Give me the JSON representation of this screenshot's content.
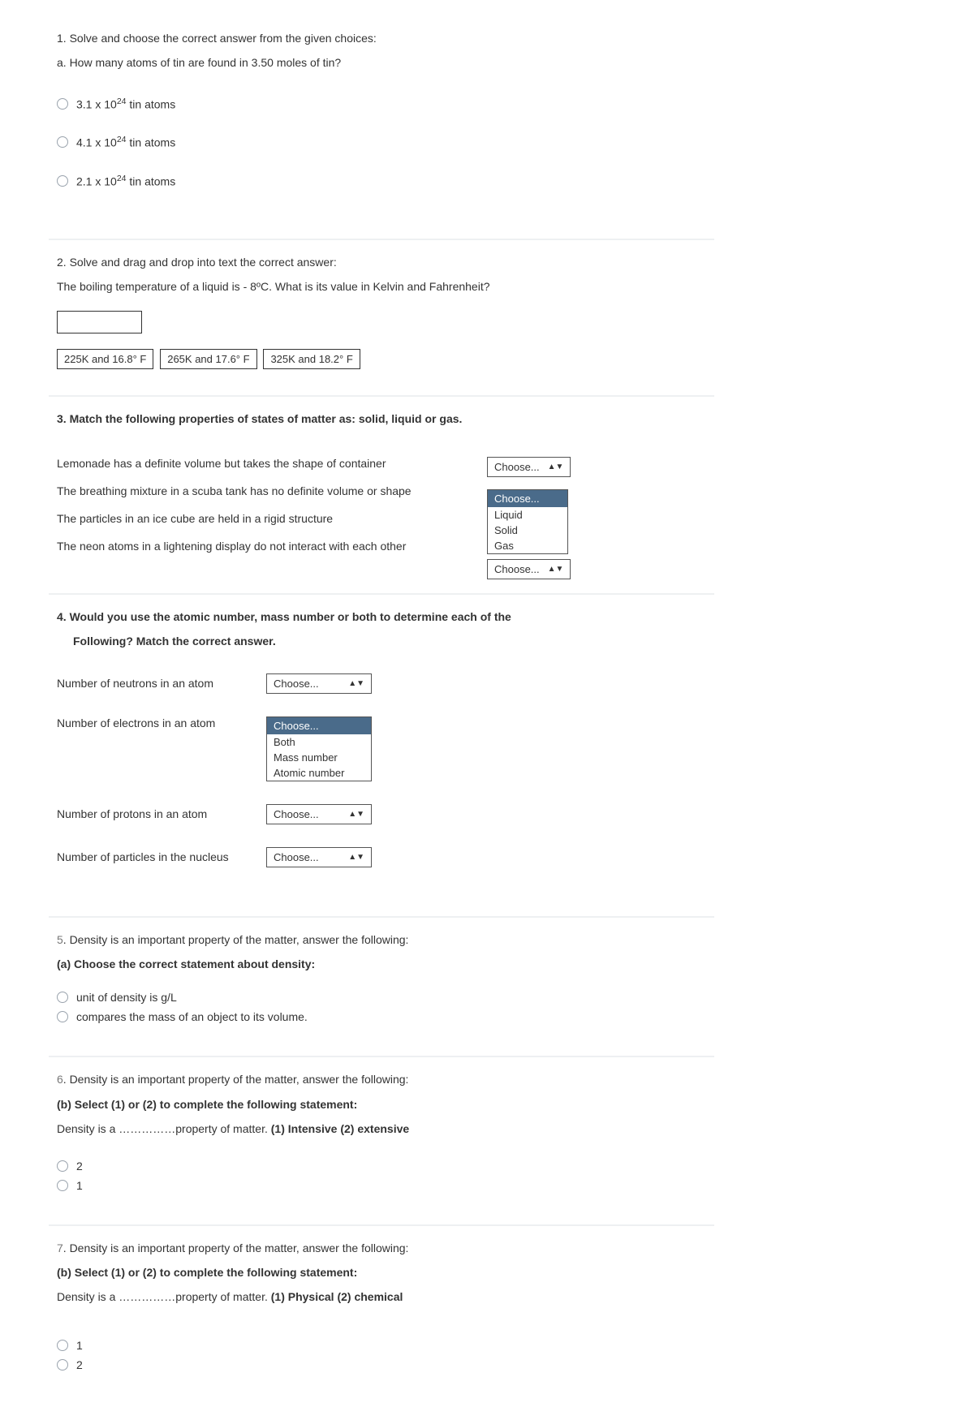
{
  "q1": {
    "header": "1. Solve and choose the correct answer from the given choices:",
    "sub": "a. How many atoms of tin are found in 3.50 moles of tin?",
    "opts": {
      "a_pre": "3.1 x 10",
      "a_sup": "24",
      "a_post": " tin atoms",
      "b_pre": "4.1 x 10",
      "b_sup": "24",
      "b_post": " tin atoms",
      "c_pre": "2.1 x 10",
      "c_sup": "24",
      "c_post": " tin atoms"
    }
  },
  "q2": {
    "header": "2.  Solve and drag and drop into text the correct answer:",
    "body": "The boiling temperature of a liquid is - 8ºC. What is its value in Kelvin and Fahrenheit?",
    "chips": {
      "a": "225K and 16.8° F",
      "b": "265K  and 17.6° F",
      "c": "325K and 18.2° F"
    }
  },
  "q3": {
    "header": "3. Match the following properties of states of matter as: solid, liquid or gas.",
    "rows": {
      "a": "Lemonade has a definite volume but takes the shape of container",
      "b": "The breathing mixture in a scuba tank has no definite volume or shape",
      "c": "The particles in an ice cube are held in a rigid structure",
      "d": "The neon atoms in a lightening display do not interact with each other"
    },
    "choose_label": "Choose...",
    "open_opts": {
      "h": "Choose...",
      "o1": "Liquid",
      "o2": "Solid",
      "o3": "Gas"
    }
  },
  "q4": {
    "header1": "4.  Would you use the atomic number, mass number or both to determine each of the",
    "header2": "Following? Match the correct answer.",
    "rows": {
      "a": "Number of neutrons in an atom",
      "b": "Number of electrons in an atom",
      "c": "Number of protons in an atom",
      "d": "Number of particles in the nucleus"
    },
    "choose_label": "Choose...",
    "open_opts": {
      "h": "Choose...",
      "o1": "Both",
      "o2": "Mass number",
      "o3": "Atomic number"
    }
  },
  "q5": {
    "lead_pre": "5",
    "lead_post": ". Density is an important property of the matter, answer the following:",
    "sub": "(a) Choose the correct statement about density:",
    "opts": {
      "a": "unit of density is g/L",
      "b": "compares the mass of an object to its volume."
    }
  },
  "q6": {
    "lead_pre": "6",
    "lead_post": ". Density is an important property of the matter, answer the following:",
    "sub": " (b) Select (1) or (2) to complete the following statement:",
    "stmt_pre": "Density is a ……………property of matter. ",
    "stmt_bold": "(1) Intensive (2) extensive",
    "opts": {
      "a": "2",
      "b": "1"
    }
  },
  "q7": {
    "lead_pre": "7",
    "lead_post": ". Density is an important property of the matter, answer the following:",
    "sub": " (b) Select (1) or (2) to complete the following statement:",
    "stmt_pre": "Density is a ……………property of matter. ",
    "stmt_bold": "(1) Physical (2) chemical",
    "opts": {
      "a": "1",
      "b": "2"
    }
  }
}
